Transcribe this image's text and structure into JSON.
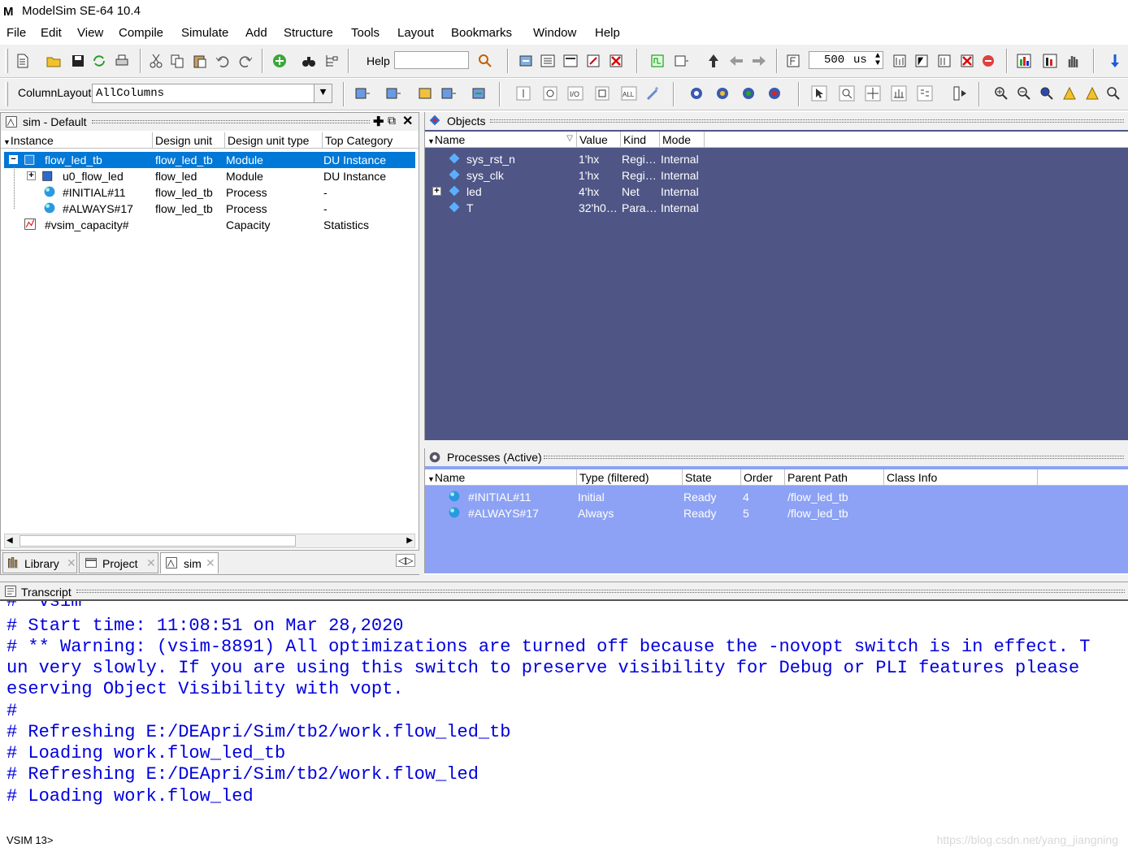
{
  "title": "ModelSim SE-64 10.4",
  "logo": "M",
  "menu": [
    "File",
    "Edit",
    "View",
    "Compile",
    "Simulate",
    "Add",
    "Structure",
    "Tools",
    "Layout",
    "Bookmarks",
    "Window",
    "Help"
  ],
  "toolbar": {
    "help_label": "Help",
    "help_value": "",
    "run_length": "500",
    "run_unit": "us",
    "column_layout_label": "ColumnLayout",
    "column_layout_value": "AllColumns"
  },
  "sim_pane": {
    "title": "sim - Default",
    "columns": [
      "Instance",
      "Design unit",
      "Design unit type",
      "Top Category"
    ],
    "rows": [
      {
        "instance": "flow_led_tb",
        "design_unit": "flow_led_tb",
        "type": "Module",
        "category": "DU Instance",
        "selected": true
      },
      {
        "instance": "u0_flow_led",
        "design_unit": "flow_led",
        "type": "Module",
        "category": "DU Instance"
      },
      {
        "instance": "#INITIAL#11",
        "design_unit": "flow_led_tb",
        "type": "Process",
        "category": "-"
      },
      {
        "instance": "#ALWAYS#17",
        "design_unit": "flow_led_tb",
        "type": "Process",
        "category": "-"
      },
      {
        "instance": "#vsim_capacity#",
        "design_unit": "",
        "type": "Capacity",
        "category": "Statistics"
      }
    ],
    "tabs": [
      {
        "label": "Library",
        "icon": "library-icon"
      },
      {
        "label": "Project",
        "icon": "project-icon"
      },
      {
        "label": "sim",
        "icon": "sim-icon",
        "active": true
      }
    ]
  },
  "objects_pane": {
    "title": "Objects",
    "columns": [
      "Name",
      "Value",
      "Kind",
      "Mode"
    ],
    "rows": [
      {
        "name": "sys_rst_n",
        "value": "1'hx",
        "kind": "Regi…",
        "mode": "Internal"
      },
      {
        "name": "sys_clk",
        "value": "1'hx",
        "kind": "Regi…",
        "mode": "Internal"
      },
      {
        "name": "led",
        "value": "4'hx",
        "kind": "Net",
        "mode": "Internal",
        "expandable": true
      },
      {
        "name": "T",
        "value": "32'h0…",
        "kind": "Para…",
        "mode": "Internal"
      }
    ]
  },
  "processes_pane": {
    "title": "Processes (Active)",
    "columns": [
      "Name",
      "Type (filtered)",
      "State",
      "Order",
      "Parent Path",
      "Class Info"
    ],
    "rows": [
      {
        "name": "#INITIAL#11",
        "type": "Initial",
        "state": "Ready",
        "order": "4",
        "parent": "/flow_led_tb",
        "class_info": ""
      },
      {
        "name": "#ALWAYS#17",
        "type": "Always",
        "state": "Ready",
        "order": "5",
        "parent": "/flow_led_tb",
        "class_info": ""
      }
    ]
  },
  "transcript": {
    "title": "Transcript",
    "lines": [
      "#  vsim",
      "# Start time: 11:08:51 on Mar 28,2020",
      "# ** Warning: (vsim-8891) All optimizations are turned off because the -novopt switch is in effect. T",
      "un very slowly. If you are using this switch to preserve visibility for Debug or PLI features please",
      "eserving Object Visibility with vopt.",
      "#",
      "# Refreshing E:/DEApri/Sim/tb2/work.flow_led_tb",
      "# Loading work.flow_led_tb",
      "# Refreshing E:/DEApri/Sim/tb2/work.flow_led",
      "# Loading work.flow_led"
    ],
    "prompt": "VSIM 13>"
  },
  "watermark": "https://blog.csdn.net/yang_jiangning"
}
